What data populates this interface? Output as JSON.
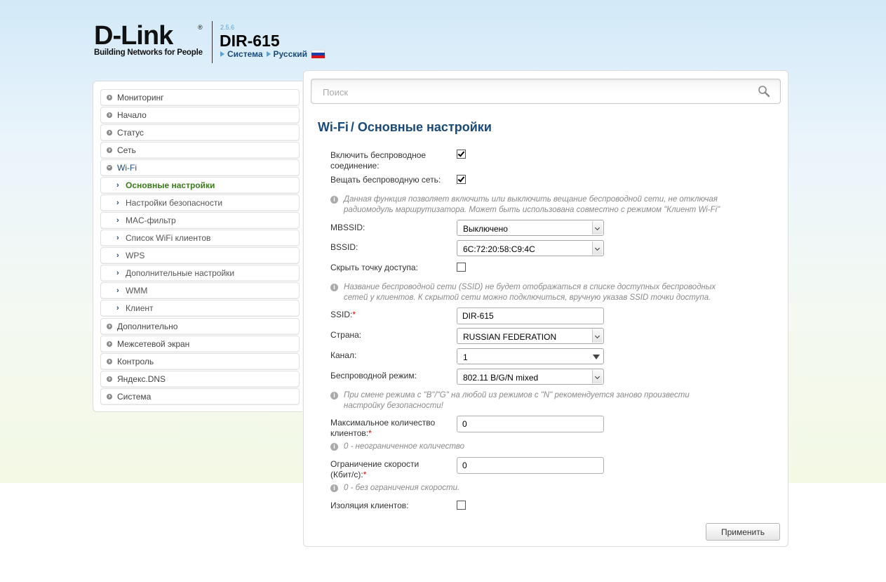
{
  "header": {
    "logo_text": "D-Link",
    "logo_reg": "®",
    "tagline": "Building Networks for People",
    "fw_version": "2.5.6",
    "model": "DIR-615",
    "links": [
      "Система",
      "Русский"
    ]
  },
  "sidebar": {
    "items": [
      {
        "label": "Мониторинг"
      },
      {
        "label": "Начало"
      },
      {
        "label": "Статус"
      },
      {
        "label": "Сеть"
      },
      {
        "label": "Wi-Fi"
      },
      {
        "label": "Основные настройки"
      },
      {
        "label": "Настройки безопасности"
      },
      {
        "label": "MAC-фильтр"
      },
      {
        "label": "Список WiFi клиентов"
      },
      {
        "label": "WPS"
      },
      {
        "label": "Дополнительные настройки"
      },
      {
        "label": "WMM"
      },
      {
        "label": "Клиент"
      },
      {
        "label": "Дополнительно"
      },
      {
        "label": "Межсетевой экран"
      },
      {
        "label": "Контроль"
      },
      {
        "label": "Яндекс.DNS"
      },
      {
        "label": "Система"
      }
    ]
  },
  "search": {
    "placeholder": "Поиск"
  },
  "page": {
    "breadcrumb": "Wi-Fi",
    "separator": "/",
    "title": "Основные настройки"
  },
  "form": {
    "enable_wireless": {
      "label_line1": "Включить беспроводное",
      "label_line2": "соединение:",
      "checked": true
    },
    "broadcast": {
      "label": "Вещать беспроводную сеть:",
      "checked": true
    },
    "hint_broadcast": {
      "line1": "Данная функция позволяет включить или выключить вещание беспроводной сети, не отключая",
      "line2": "радиомодуль маршрутизатора. Может быть использована совместно с режимом \"Клиент Wi-Fi\""
    },
    "mbssid": {
      "label": "MBSSID:",
      "value": "Выключено"
    },
    "bssid": {
      "label": "BSSID:",
      "value": "6C:72:20:58:C9:4C"
    },
    "hide_ap": {
      "label": "Скрыть точку доступа:",
      "checked": false
    },
    "hint_hide": {
      "line1": "Название беспроводной сети (SSID) не будет отображаться в списке доступных беспроводных",
      "line2": "сетей у клиентов. К скрытой сети можно подключиться, вручную указав SSID точки доступа."
    },
    "ssid": {
      "label": "SSID:",
      "required_mark": "*",
      "value": "DIR-615"
    },
    "country": {
      "label": "Страна:",
      "value": "RUSSIAN FEDERATION"
    },
    "channel": {
      "label": "Канал:",
      "value": "1"
    },
    "mode": {
      "label": "Беспроводной режим:",
      "value": "802.11 B/G/N mixed"
    },
    "hint_mode": {
      "line1": "При смене режима с \"B\"/\"G\" на любой из режимов с \"N\" рекомендуется заново произвести",
      "line2": "настройку безопасности!"
    },
    "max_clients": {
      "label_line1": "Максимальное количество",
      "label_line2": "клиентов:",
      "required_mark": "*",
      "value": "0"
    },
    "hint_max_clients": "0 - неограниченное количество",
    "speed_limit": {
      "label_line1": "Ограничение скорости",
      "label_line2": "(Кбит/с):",
      "required_mark": "*",
      "value": "0"
    },
    "hint_speed": "0 - без ограничения скорости.",
    "isolation": {
      "label": "Изоляция клиентов:",
      "checked": false
    },
    "info_glyph": "i"
  },
  "apply_label": "Применить",
  "colors": {
    "title": "#1a4a7a",
    "active_menu": "#3a7a1a",
    "required": "#dd0000",
    "flag": [
      "#ffffff",
      "#1c3fa8",
      "#d8141c"
    ]
  },
  "icons": {
    "search": "search-icon",
    "bullet": "circle-arrow-icon",
    "submenu": "chevron-right-icon",
    "info": "info-icon",
    "flag": "russian-flag-icon"
  }
}
